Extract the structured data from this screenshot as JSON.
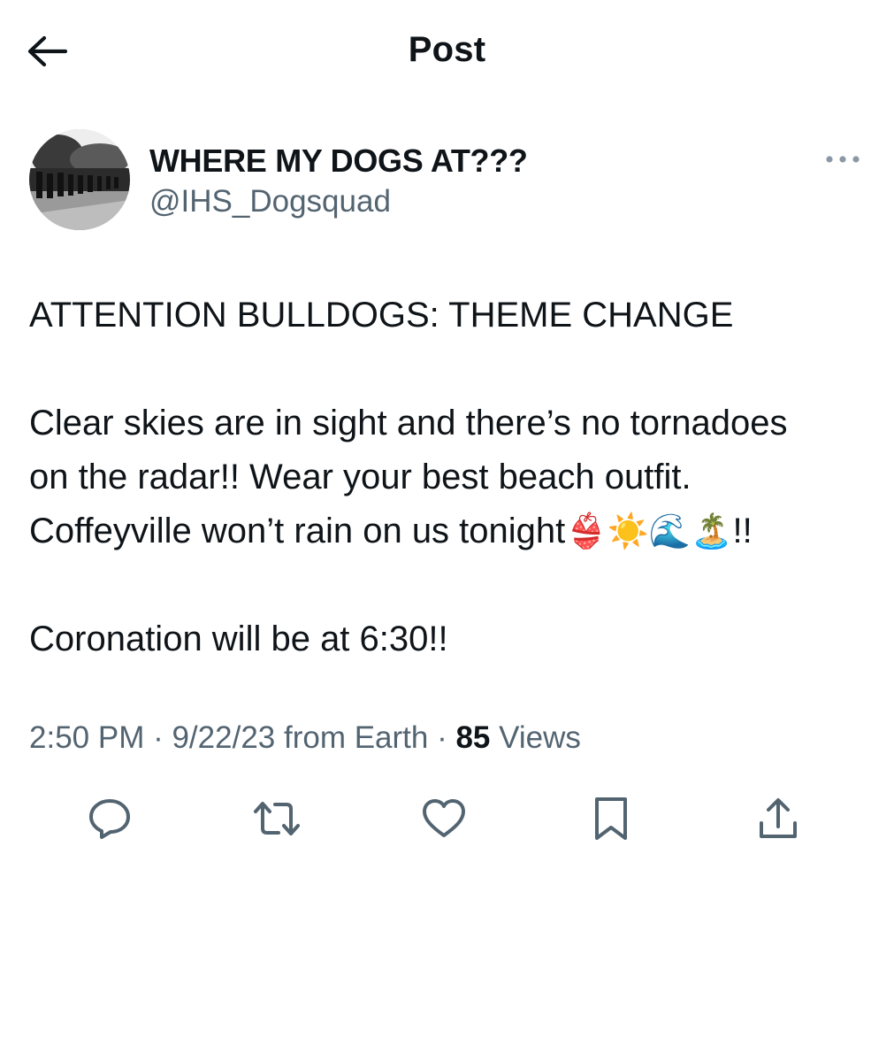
{
  "header": {
    "back_icon": "arrow-left-icon",
    "title": "Post"
  },
  "author": {
    "display_name": "WHERE MY DOGS AT???",
    "handle": "@IHS_Dogsquad",
    "more_icon": "more-horizontal-icon"
  },
  "tweet": {
    "line1": "ATTENTION BULLDOGS: THEME CHANGE",
    "line2": "Clear skies are in sight and there’s no tornadoes",
    "line3": "on the radar!! Wear your best beach outfit.",
    "line4_text": "Coffeyville won’t rain on us tonight",
    "line4_emojis": "👙☀️🌊🏝️",
    "line4_end": "!!",
    "line5": "Coronation will be at 6:30!!"
  },
  "meta": {
    "time": "2:50 PM",
    "sep1": " · ",
    "date_source": "9/22/23 from Earth",
    "sep2": " · ",
    "views_count": "85",
    "views_label": " Views"
  },
  "actions": [
    {
      "icon": "reply-icon"
    },
    {
      "icon": "retweet-icon"
    },
    {
      "icon": "like-icon"
    },
    {
      "icon": "bookmark-icon"
    },
    {
      "icon": "share-icon"
    }
  ],
  "colors": {
    "text": "#0f1419",
    "secondary": "#536471"
  }
}
